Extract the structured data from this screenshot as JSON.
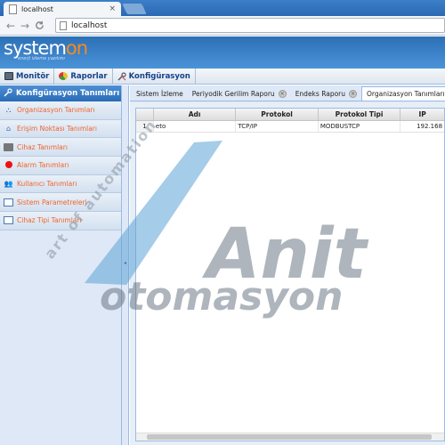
{
  "browser": {
    "tab_title": "localhost",
    "tab_close": "×",
    "url": "localhost",
    "back_glyph": "←",
    "forward_glyph": "→",
    "reload_glyph": "C"
  },
  "logo": {
    "main_prefix": "system",
    "main_accent": "on",
    "subtitle": "enerji izleme yazılımı",
    "accent_color": "#f58a1f"
  },
  "menu": {
    "items": [
      {
        "label": "Monitör",
        "icon": "monitor-icon"
      },
      {
        "label": "Raporlar",
        "icon": "reports-icon"
      },
      {
        "label": "Konfigürasyon",
        "icon": "tools-icon"
      }
    ]
  },
  "leftpanel": {
    "title": "Konfigürasyon Tanımları",
    "items": [
      {
        "label": "Organizasyon Tanımları",
        "icon": "organization-icon"
      },
      {
        "label": "Erişim Noktası Tanımları",
        "icon": "access-point-icon"
      },
      {
        "label": "Cihaz Tanımları",
        "icon": "device-icon"
      },
      {
        "label": "Alarm Tanımları",
        "icon": "alarm-icon"
      },
      {
        "label": "Kullanıcı Tanımları",
        "icon": "users-icon"
      },
      {
        "label": "Sistem Parametreleri",
        "icon": "window-icon"
      },
      {
        "label": "Cihaz Tipi Tanımları",
        "icon": "window-icon"
      }
    ]
  },
  "tabs": [
    {
      "label": "Sistem İzleme",
      "closable": false
    },
    {
      "label": "Periyodik Gerilim Raporu",
      "closable": true
    },
    {
      "label": "Endeks Raporu",
      "closable": true
    },
    {
      "label": "Organizasyon Tanımları",
      "closable": true
    }
  ],
  "grid": {
    "columns": [
      "",
      "Adı",
      "Protokol",
      "Protokol Tipi",
      "IP"
    ],
    "rows": [
      [
        "1",
        "eto",
        "TCP/IP",
        "MODBUSTCP",
        "192.168"
      ]
    ]
  },
  "watermark": {
    "brand": "Anit",
    "name": "otomasyon",
    "tagline": "art of automation"
  }
}
